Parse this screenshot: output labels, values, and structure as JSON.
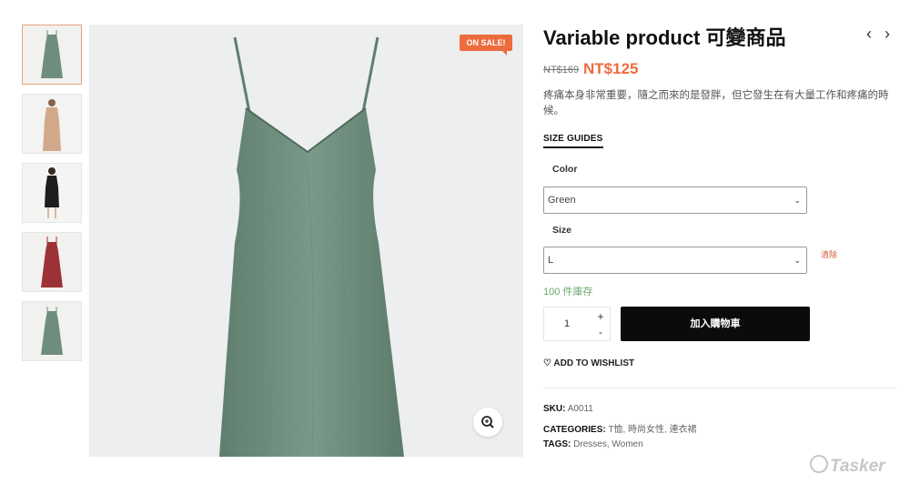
{
  "product": {
    "title": "Variable product 可變商品",
    "old_price": "NT$169",
    "new_price": "NT$125",
    "sale_badge": "ON SALE!",
    "description": "疼痛本身非常重要，隨之而來的是發胖，但它發生在有大量工作和疼痛的時候。",
    "size_guides": "SIZE GUIDES"
  },
  "nav": {
    "prev": "‹",
    "next": "›"
  },
  "thumbnails": [
    {
      "name": "green-dress",
      "color": "#6f8d7c",
      "active": true
    },
    {
      "name": "beige-dress",
      "color": "#d1a98a",
      "active": false
    },
    {
      "name": "black-dress",
      "color": "#1e1e1e",
      "active": false
    },
    {
      "name": "red-dress",
      "color": "#9c3236",
      "active": false
    },
    {
      "name": "green-dress-back",
      "color": "#6f8d7c",
      "active": false
    }
  ],
  "options": {
    "color_label": "Color",
    "color_value": "Green",
    "size_label": "Size",
    "size_value": "L",
    "clear_label": "清除"
  },
  "stock": "100 件庫存",
  "quantity": {
    "value": "1",
    "plus": "+",
    "minus": "-"
  },
  "cart_button": "加入購物車",
  "wishlist": "ADD TO WISHLIST",
  "meta": {
    "sku_label": "SKU:",
    "sku_value": "A0011",
    "categories_label": "CATEGORIES:",
    "categories": [
      "T恤",
      "時尚女性",
      "連衣裙"
    ],
    "tags_label": "TAGS:",
    "tags": [
      "Dresses",
      "Women"
    ]
  },
  "watermark": "Tasker",
  "colors": {
    "accent": "#ee6b3e",
    "button": "#0b0b0b",
    "stock": "#6ba86b",
    "dress": "#6f8d7c"
  }
}
